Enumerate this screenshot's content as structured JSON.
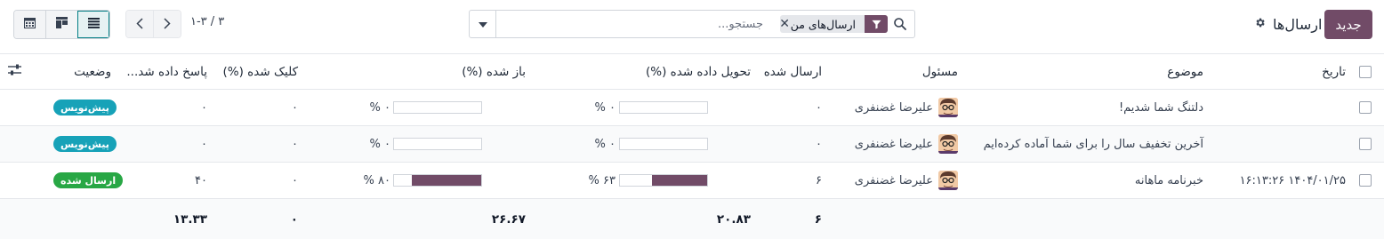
{
  "header": {
    "new_button": "جدید",
    "title": "ارسال‌ها",
    "gear_icon": "gear-icon"
  },
  "search": {
    "facet_label": "ارسال‌های من",
    "facet_icon": "filter-icon",
    "placeholder": "جستجو...",
    "value": ""
  },
  "pager": {
    "value": "۱-۳ / ۳"
  },
  "view_switcher": {
    "active": "list",
    "views": [
      "list",
      "kanban",
      "calendar"
    ]
  },
  "columns": {
    "date": "تاریخ",
    "subject": "موضوع",
    "responsible": "مسئول",
    "sent": "ارسال شده",
    "delivered": "تحویل داده شده (%)",
    "opened": "باز شده (%)",
    "clicked": "کلیک شده (%)",
    "replied": "پاسخ داده شد...",
    "status": "وضعیت"
  },
  "rows": [
    {
      "date": "",
      "subject": "دلتنگ شما شدیم!",
      "responsible": "علیرضا غضنفری",
      "sent": "۰",
      "delivered_value": 0,
      "delivered_text": "۰ %",
      "opened_value": 0,
      "opened_text": "۰ %",
      "clicked": "۰",
      "replied": "۰",
      "status": "پیش‌نویس",
      "status_color": "#17a2b8"
    },
    {
      "date": "",
      "subject": "آخرین تخفیف سال را برای شما آماده کرده‌ایم",
      "responsible": "علیرضا غضنفری",
      "sent": "۰",
      "delivered_value": 0,
      "delivered_text": "۰ %",
      "opened_value": 0,
      "opened_text": "۰ %",
      "clicked": "۰",
      "replied": "۰",
      "status": "پیش‌نویس",
      "status_color": "#17a2b8"
    },
    {
      "date": "۱۴۰۴/۰۱/۲۵ ۱۶:۱۳:۲۶",
      "subject": "خبرنامه ماهانه",
      "responsible": "علیرضا غضنفری",
      "sent": "۶",
      "delivered_value": 63,
      "delivered_text": "۶۳ %",
      "opened_value": 80,
      "opened_text": "۸۰ %",
      "clicked": "۰",
      "replied": "۴۰",
      "status": "ارسال شده",
      "status_color": "#28a745"
    }
  ],
  "totals": {
    "sent": "۶",
    "delivered": "۲۰.۸۳",
    "opened": "۲۶.۶۷",
    "clicked": "۰",
    "replied": "۱۳.۳۳"
  },
  "colors": {
    "brand": "#714B67",
    "accent": "#017e84"
  }
}
